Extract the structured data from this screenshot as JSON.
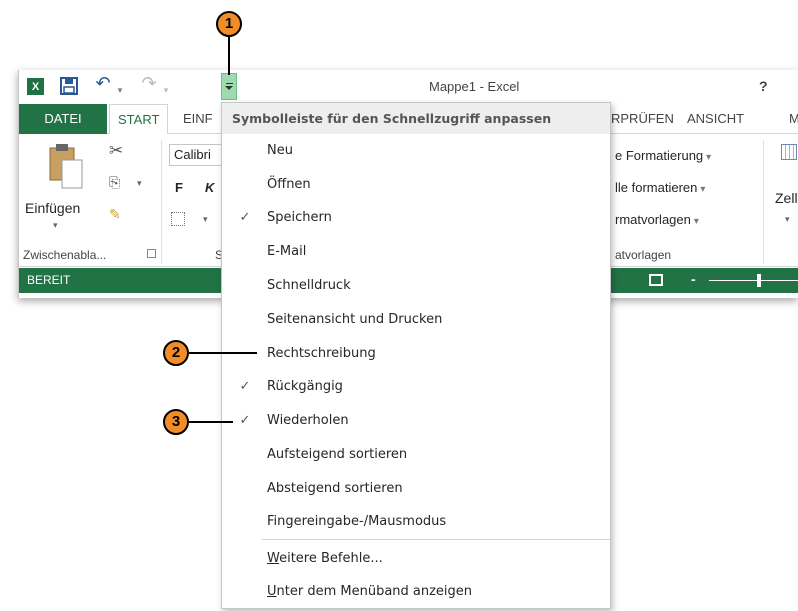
{
  "window": {
    "title": "Mappe1 - Excel",
    "help": "?",
    "app_logo": "X"
  },
  "quick_access": {
    "save_icon": "save-icon",
    "undo_icon": "undo-icon",
    "redo_icon": "redo-icon",
    "customize_icon": "customize-quick-access-icon"
  },
  "tabs": {
    "file": "DATEI",
    "start": "START",
    "insert_partial": "EINF",
    "review_partial": "RPRÜFEN",
    "view": "ANSICHT",
    "more_partial": "M"
  },
  "ribbon": {
    "paste_label": "Einfügen",
    "clipboard_group": "Zwischenabla...",
    "font_name_partial": "Calibri",
    "bold": "F",
    "italic": "K",
    "cond_format": "e Formatierung",
    "table_format": "lle formatieren",
    "cell_styles": "rmatvorlagen",
    "styles_group": "atvorlagen",
    "cells_label_partial": "Zelle",
    "font_group_partial": "S",
    "dropdown_arrow": "▾"
  },
  "status": {
    "text": "BEREIT"
  },
  "menu": {
    "header": "Symbolleiste für den Schnellzugriff anpassen",
    "check_glyph": "✓",
    "items": [
      {
        "label": "Neu",
        "checked": false
      },
      {
        "label": "Öffnen",
        "checked": false
      },
      {
        "label": "Speichern",
        "checked": true
      },
      {
        "label": "E-Mail",
        "checked": false
      },
      {
        "label": "Schnelldruck",
        "checked": false
      },
      {
        "label": "Seitenansicht und Drucken",
        "checked": false
      },
      {
        "label": "Rechtschreibung",
        "checked": false
      },
      {
        "label": "Rückgängig",
        "checked": true
      },
      {
        "label": "Wiederholen",
        "checked": true
      },
      {
        "label": "Aufsteigend sortieren",
        "checked": false
      },
      {
        "label": "Absteigend sortieren",
        "checked": false
      },
      {
        "label": "Fingereingabe-/Mausmodus",
        "checked": false
      }
    ],
    "more_commands": {
      "accel": "W",
      "rest": "eitere Befehle..."
    },
    "show_below": {
      "accel": "U",
      "rest": "nter dem Menüband anzeigen"
    }
  },
  "callouts": [
    "1",
    "2",
    "3"
  ],
  "colors": {
    "excel_green": "#217346",
    "callout_orange": "#f28c28",
    "qat_highlight": "#9fd9b0"
  }
}
